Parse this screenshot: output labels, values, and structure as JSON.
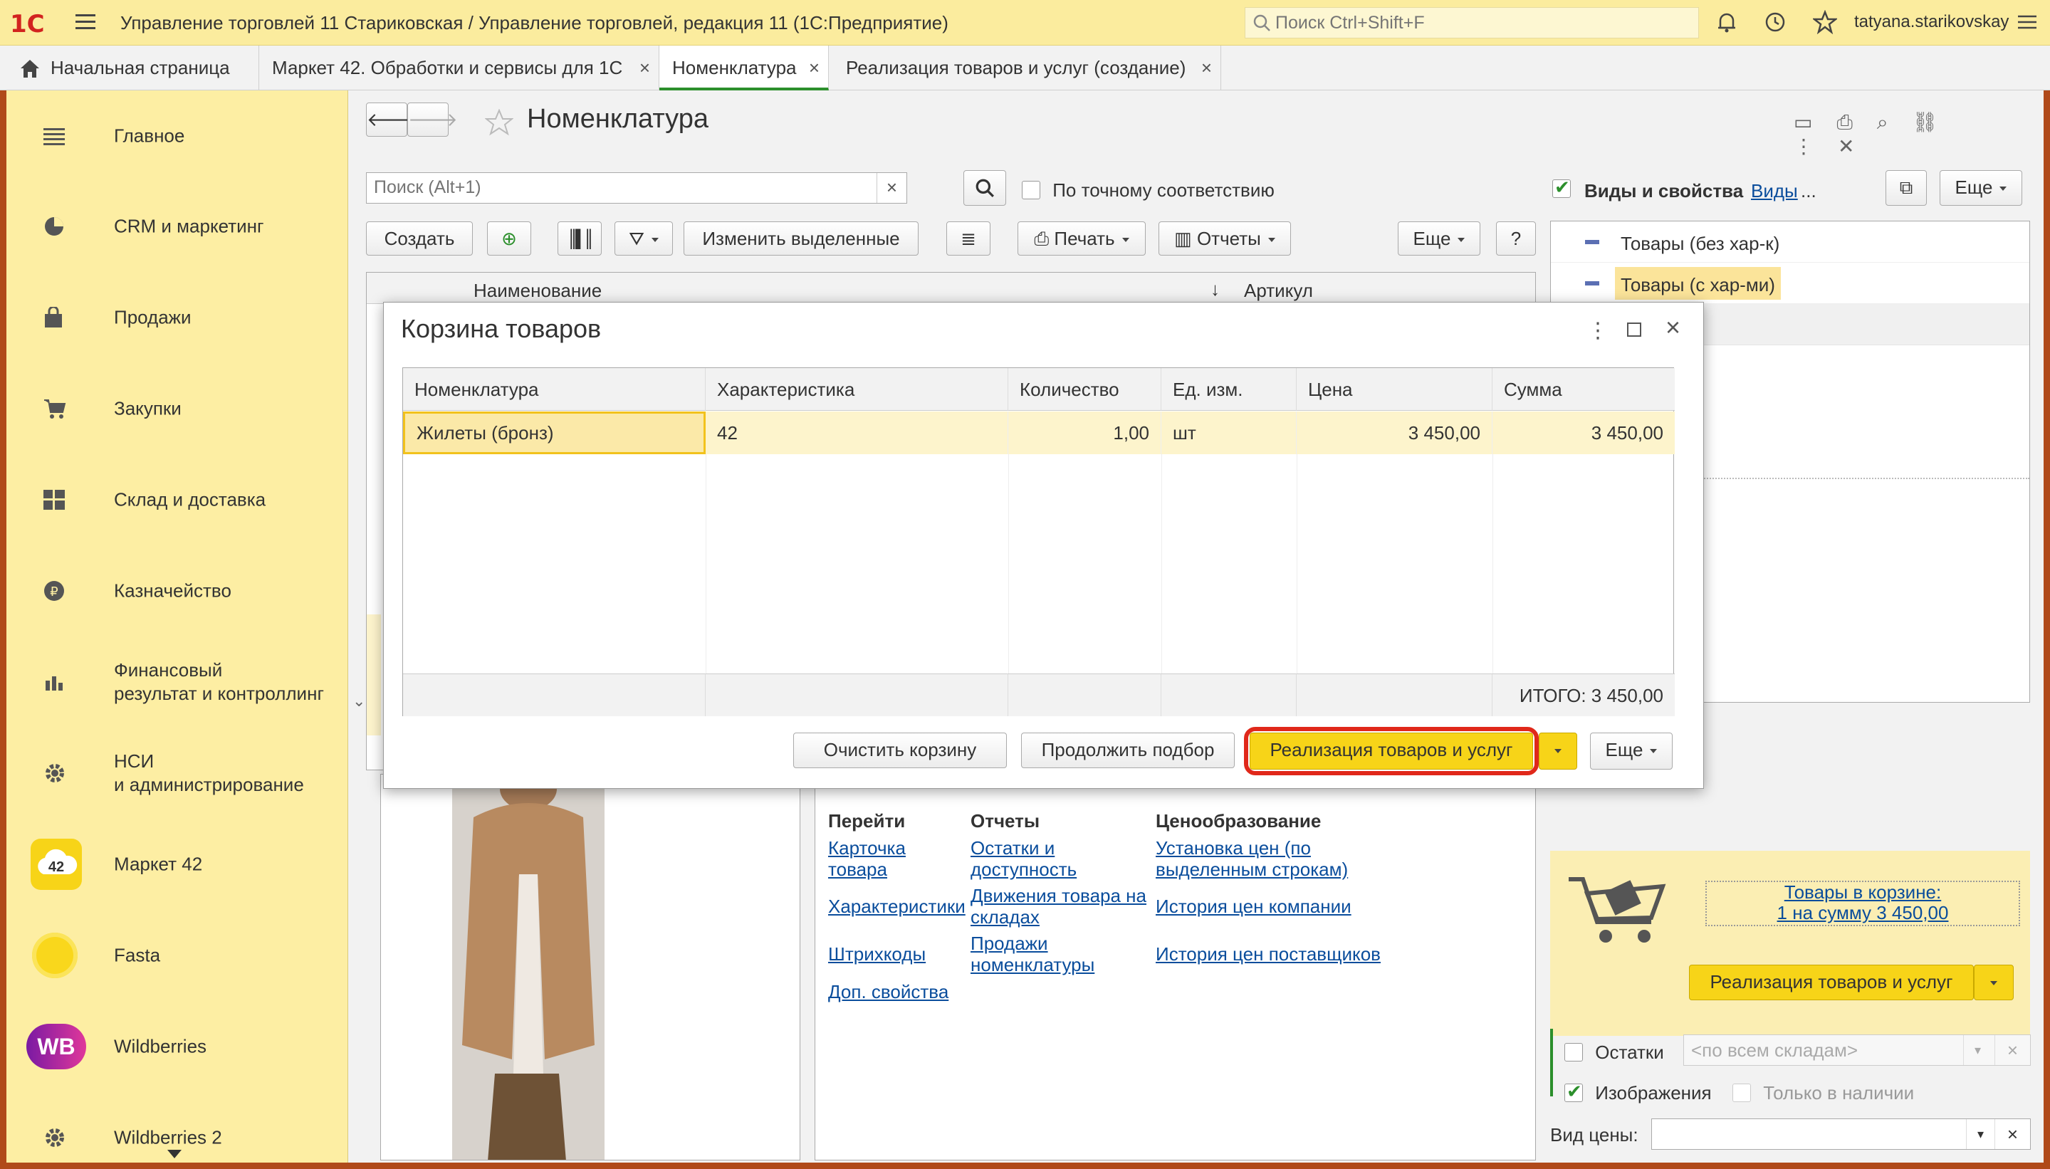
{
  "app": {
    "logo": "1С",
    "title": "Управление торговлей 11 Стариковская / Управление торговлей, редакция 11  (1С:Предприятие)",
    "search_placeholder": "Поиск Ctrl+Shift+F",
    "user": "tatyana.starikovskay"
  },
  "tabs": [
    {
      "label": "Начальная страница"
    },
    {
      "label": "Маркет 42. Обработки и сервисы для 1С"
    },
    {
      "label": "Номенклатура"
    },
    {
      "label": "Реализация товаров и услуг (создание)"
    }
  ],
  "sidebar": {
    "items": [
      {
        "label": "Главное",
        "icon": "menu-icon"
      },
      {
        "label": "CRM и маркетинг",
        "icon": "pie-chart-icon"
      },
      {
        "label": "Продажи",
        "icon": "shopping-bag-icon"
      },
      {
        "label": "Закупки",
        "icon": "cart-icon"
      },
      {
        "label": "Склад и доставка",
        "icon": "grid-icon"
      },
      {
        "label": "Казначейство",
        "icon": "ruble-coin-icon"
      },
      {
        "label": "Финансовый\nрезультат и контроллинг",
        "icon": "bar-chart-icon"
      },
      {
        "label": "НСИ\nи администрирование",
        "icon": "gear-icon"
      },
      {
        "label": "Маркет 42",
        "icon": "market42-cloud-icon",
        "badge": "42"
      },
      {
        "label": "Fasta",
        "icon": "fasta-circle-icon"
      },
      {
        "label": "Wildberries",
        "icon": "wildberries-icon",
        "badge": "WB"
      },
      {
        "label": "Wildberries 2",
        "icon": "gear-icon"
      }
    ]
  },
  "form": {
    "title": "Номенклатура",
    "search_placeholder": "Поиск (Alt+1)",
    "exact_match_label": "По точному соответствию",
    "create_btn": "Создать",
    "edit_selected_btn": "Изменить выделенные",
    "print_btn": "Печать",
    "reports_btn": "Отчеты",
    "more_btn": "Еще",
    "help_btn": "?",
    "col_name": "Наименование",
    "col_article": "Артикул",
    "sort_indicator": "↓"
  },
  "right_panel": {
    "kinds_label": "Виды и свойства",
    "kinds_link": "Виды",
    "ellipsis": "...",
    "more_btn": "Еще",
    "items": [
      {
        "label": "Товары (без хар-к)",
        "selected": false
      },
      {
        "label": "Товары (с хар-ми)",
        "selected": true
      }
    ],
    "cart_link_line1": "Товары в корзине:",
    "cart_link_line2": "1 на сумму 3 450,00",
    "sale_btn": "Реализация товаров и услуг",
    "stock_label": "Остатки",
    "stock_checked": false,
    "warehouse_placeholder": "<по всем складам>",
    "images_label": "Изображения",
    "images_checked": true,
    "in_stock_label": "Только в наличии",
    "in_stock_checked": false,
    "price_kind_label": "Вид цены:"
  },
  "links": {
    "col1_title": "Перейти",
    "col1": [
      "Карточка товара",
      "Характеристики",
      "Штрихкоды",
      "Доп. свойства"
    ],
    "col2_title": "Отчеты",
    "col2": [
      "Остатки и доступность",
      "Движения товара на складах",
      "Продажи номенклатуры"
    ],
    "col3_title": "Ценообразование",
    "col3": [
      "Установка цен (по выделенным строкам)",
      "История цен компании",
      "История цен поставщиков"
    ]
  },
  "modal": {
    "title": "Корзина товаров",
    "columns": [
      "Номенклатура",
      "Характеристика",
      "Количество",
      "Ед. изм.",
      "Цена",
      "Сумма"
    ],
    "rows": [
      [
        "Жилеты (бронз)",
        "42",
        "1,00",
        "шт",
        "3 450,00",
        "3 450,00"
      ]
    ],
    "total": "ИТОГО: 3 450,00",
    "clear_btn": "Очистить корзину",
    "continue_btn": "Продолжить подбор",
    "sale_btn": "Реализация товаров и услуг",
    "more_btn": "Еще"
  },
  "colors": {
    "accent_yellow": "#f7d418",
    "sidebar_bg": "#fdeea3",
    "topbar_bg": "#fbec9e",
    "highlight_red": "#e0281a",
    "frame": "#b04a1a"
  }
}
